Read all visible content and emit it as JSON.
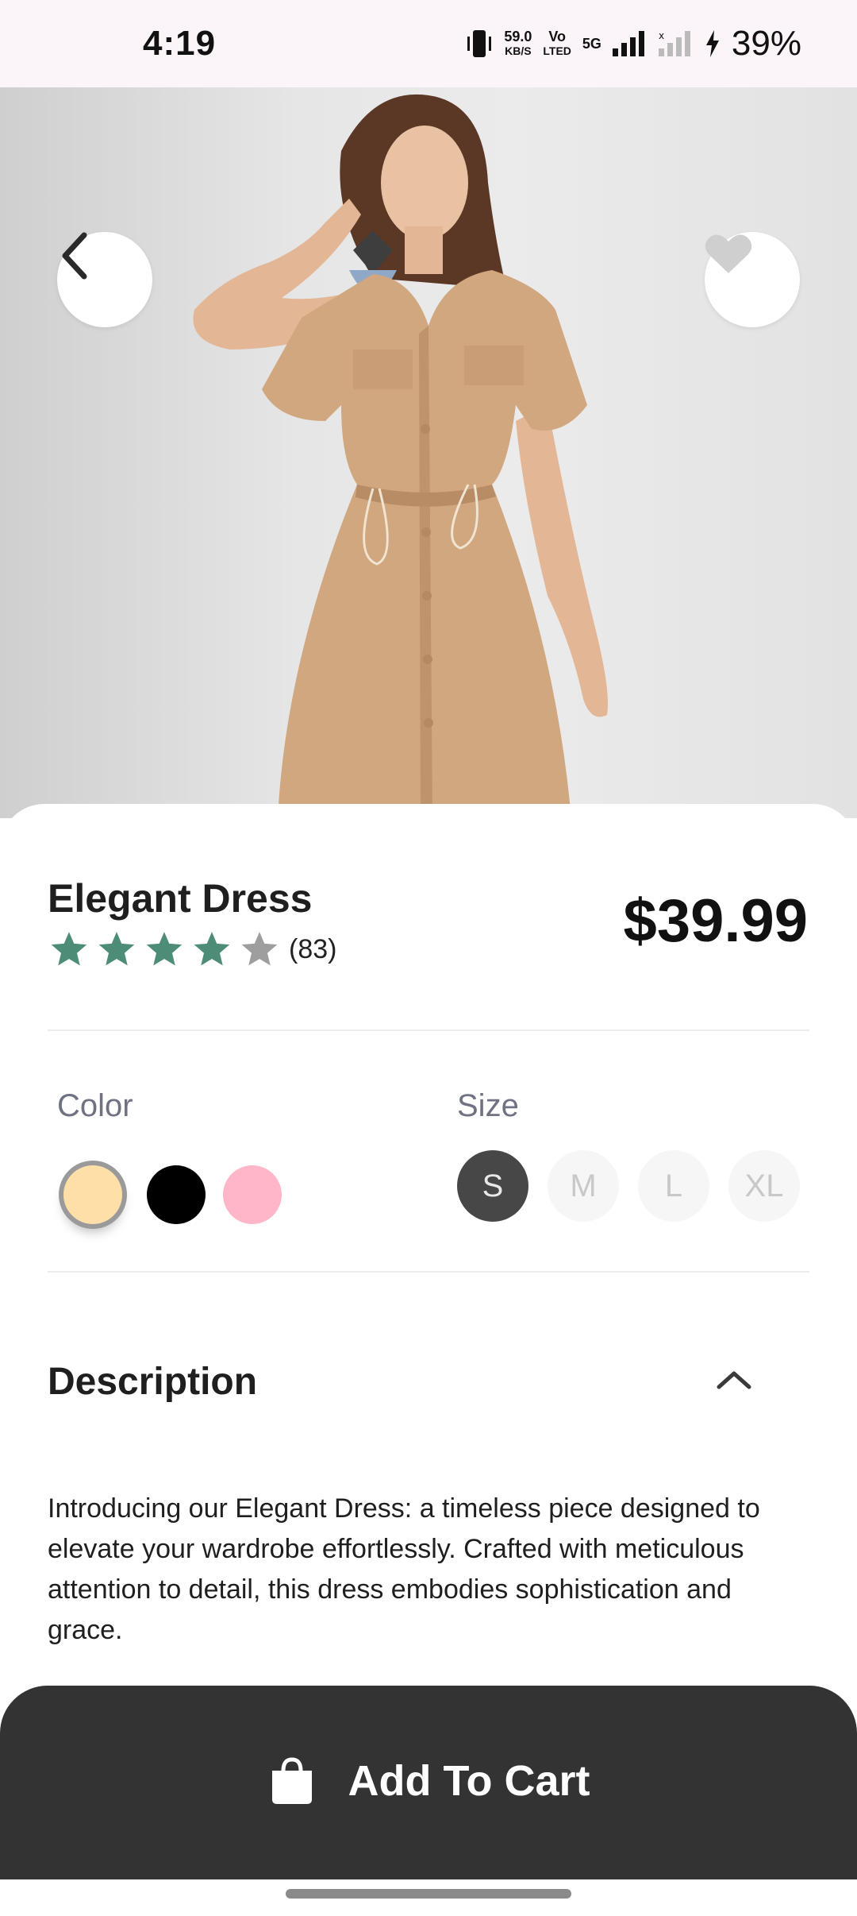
{
  "status_bar": {
    "time": "4:19",
    "net_speed": "59.0",
    "net_unit": "KB/S",
    "volte_top": "Vo",
    "volte_bottom": "LTED",
    "signal_label": "5G",
    "battery": "39%"
  },
  "product": {
    "title": "Elegant Dress",
    "price": "$39.99",
    "rating_stars": 4,
    "rating_max": 5,
    "rating_count": "(83)"
  },
  "options": {
    "color_label": "Color",
    "colors": [
      "#ffdfa8",
      "#000000",
      "#ffb6c8"
    ],
    "selected_color_index": 0,
    "size_label": "Size",
    "sizes": [
      "S",
      "M",
      "L",
      "XL"
    ],
    "selected_size": "S"
  },
  "description": {
    "heading": "Description",
    "text": "Introducing our Elegant Dress: a timeless piece designed to elevate your wardrobe effortlessly. Crafted with meticulous attention to detail, this dress embodies sophistication and grace."
  },
  "cart": {
    "label": "Add To Cart"
  },
  "colors": {
    "star_active": "#4d8d77",
    "star_inactive": "#9e9e9e",
    "cart_bg": "#333333"
  }
}
